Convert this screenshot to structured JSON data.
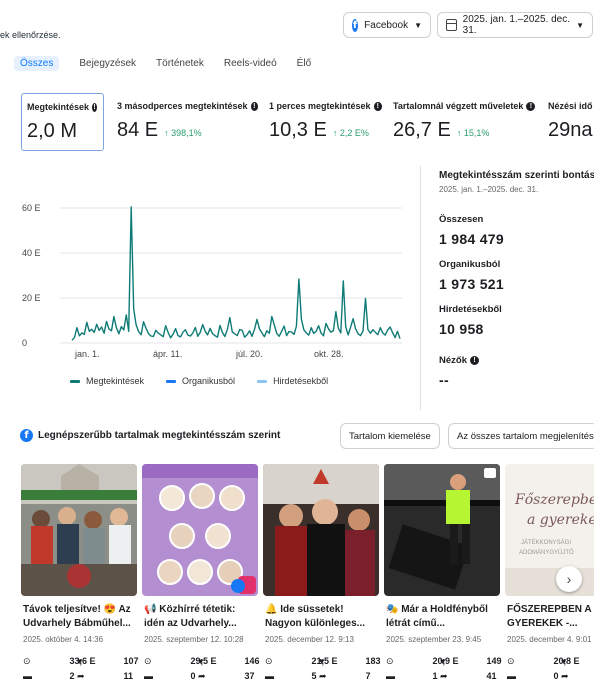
{
  "topbar": {
    "hint": "ek ellenőrzése.",
    "platform_label": "Facebook",
    "date_range": "2025. jan. 1.–2025. dec. 31."
  },
  "tabs": [
    {
      "label": "Összes",
      "active": true
    },
    {
      "label": "Bejegyzések"
    },
    {
      "label": "Történetek"
    },
    {
      "label": "Reels-videó"
    },
    {
      "label": "Élő"
    }
  ],
  "metrics": [
    {
      "label": "Megtekintések",
      "value": "2,0 M",
      "delta": ""
    },
    {
      "label": "3 másodperces megtekintések",
      "value": "84 E",
      "delta": "↑ 398,1%"
    },
    {
      "label": "1 perces megtekintések",
      "value": "10,3 E",
      "delta": "↑ 2,2 E%"
    },
    {
      "label": "Tartalomnál végzett műveletek",
      "value": "26,7 E",
      "delta": "↑ 15,1%"
    },
    {
      "label": "Nézési idő",
      "value": "29na",
      "delta": ""
    }
  ],
  "chart_data": {
    "type": "line",
    "xlabel": "",
    "ylabel": "",
    "ylim": [
      0,
      60000
    ],
    "yticks": [
      "0",
      "20 E",
      "40 E",
      "60 E"
    ],
    "xticks": [
      "jan. 1.",
      "ápr. 11.",
      "júl. 20.",
      "okt. 28."
    ],
    "series": [
      {
        "name": "Megtekintések",
        "color": "#0f7b76",
        "values": [
          1200,
          2500,
          6800,
          3200,
          4500,
          3800,
          9200,
          5200,
          6100,
          4700,
          8300,
          5600,
          7100,
          4300,
          9600,
          6200,
          5400,
          11800,
          6800,
          4100,
          7300,
          5800,
          12500,
          5200,
          60500,
          15200,
          8100,
          5100,
          3700,
          9400,
          6600,
          4200,
          3100,
          2900,
          5600,
          4400,
          3600,
          2800,
          7700,
          4600,
          2300,
          3900,
          6400,
          3300,
          2700,
          4800,
          5900,
          3500,
          3100,
          4400,
          6900,
          3000,
          4700,
          8200,
          5200,
          3600,
          6500,
          4100,
          3300,
          2600,
          7800,
          4700,
          2900,
          6100,
          11300,
          4900,
          4100,
          3300,
          6000,
          5600,
          2600,
          3700,
          5400,
          3000,
          6100,
          10500,
          6300,
          4500,
          2800,
          5400,
          4300,
          11800,
          8200,
          4300,
          3000,
          5200,
          7500,
          3300,
          5100,
          4900,
          3800,
          7400,
          28400,
          10600,
          5900,
          4500,
          3500,
          6800,
          4300,
          5200,
          7700,
          4400,
          3200,
          8700,
          6300,
          4800,
          5500,
          13900,
          6600,
          4500,
          27600,
          7200,
          3600,
          7200,
          10800,
          6300,
          4100,
          3300,
          5300,
          19800,
          6000,
          4300,
          5900,
          4800,
          3700,
          6800,
          4500,
          3500,
          5800,
          7100,
          4600,
          2400,
          5200,
          1900
        ]
      },
      {
        "name": "Organikusból",
        "color": "#1877f2",
        "values": []
      },
      {
        "name": "Hirdetésekből",
        "color": "#8ec5f0",
        "values": []
      }
    ]
  },
  "breakdown": {
    "title": "Megtekintésszám szerinti bontás",
    "subtitle": "2025. jan. 1.–2025. dec. 31.",
    "total_label": "Összesen",
    "total_value": "1 984 479",
    "organic_label": "Organikusból",
    "organic_value": "1 973 521",
    "ads_label": "Hirdetésekből",
    "ads_value": "10 958",
    "viewers_label": "Nézők",
    "viewers_value": "--"
  },
  "section": {
    "title": "Legnépszerűbb tartalmak megtekintésszám szerint",
    "btn_highlight": "Tartalom kiemelése",
    "btn_show_all": "Az összes tartalom megjelenítése"
  },
  "cards": [
    {
      "title": "Távok teljesítve! 😍 Az Udvarhely Bábműhel...",
      "date": "2025. október 4. 14:36",
      "views": "33,6 E",
      "likes": "107",
      "comments": "2",
      "shares": "11"
    },
    {
      "title": "📢 Közhírré tétetik: idén az Udvarhely...",
      "date": "2025. szeptember 12. 10:28",
      "views": "29,5 E",
      "likes": "146",
      "comments": "0",
      "shares": "37"
    },
    {
      "title": "🔔 Ide süssetek! Nagyon különleges...",
      "date": "2025. december 12. 9:13",
      "views": "21,5 E",
      "likes": "183",
      "comments": "5",
      "shares": "7"
    },
    {
      "title": "🎭 Már a Holdfényből létrát című...",
      "date": "2025. szeptember 23. 9:45",
      "views": "20,9 E",
      "likes": "149",
      "comments": "1",
      "shares": "41"
    },
    {
      "title": "FŐSZEREPBEN A GYEREKEK -...",
      "date": "2025. december 4. 9:01",
      "views": "20,8 E",
      "likes": "28",
      "comments": "0",
      "shares": "53"
    }
  ],
  "card5_overlay": {
    "line1": "Főszerepben",
    "line2": "a gyerekek",
    "line3": "JÁTÉKKONYSÁGI",
    "line4": "ADOMÁNYGYŰJTŐ"
  }
}
